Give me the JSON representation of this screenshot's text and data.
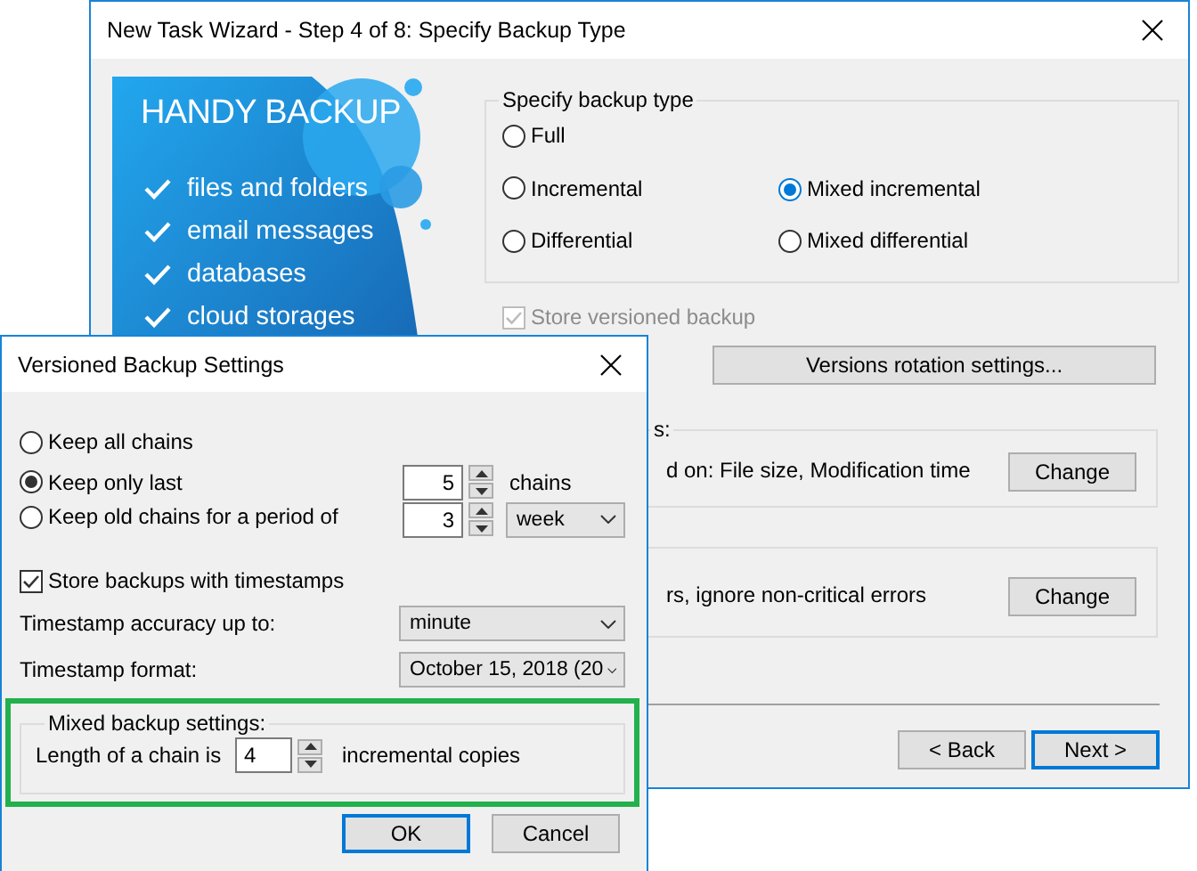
{
  "wizard": {
    "title": "New Task Wizard - Step 4 of 8: Specify Backup Type",
    "banner": {
      "title": "HANDY BACKUP",
      "features": [
        "files and folders",
        "email messages",
        "databases",
        "cloud storages"
      ]
    },
    "backup_type": {
      "label": "Specify backup type",
      "options": [
        {
          "label": "Full",
          "selected": false
        },
        {
          "label": "Incremental",
          "selected": false
        },
        {
          "label": "Mixed incremental",
          "selected": true
        },
        {
          "label": "Differential",
          "selected": false
        },
        {
          "label": "Mixed differential",
          "selected": false
        }
      ]
    },
    "store_versioned": {
      "label": "Store versioned backup",
      "checked": true,
      "disabled": true
    },
    "rotation_button": "Versions rotation settings...",
    "groups": [
      {
        "label": "s:",
        "text": "d on: File size, Modification time",
        "button": "Change"
      },
      {
        "text": "rs, ignore non-critical errors",
        "button": "Change"
      }
    ],
    "buttons": [
      {
        "label": "< Back",
        "default": false
      },
      {
        "label": "Next >",
        "default": true
      }
    ]
  },
  "dialog": {
    "title": "Versioned Backup Settings",
    "keep_options": [
      {
        "label": "Keep all chains",
        "selected": false
      },
      {
        "label": "Keep only last",
        "selected": true,
        "spin": "5",
        "unit": "chains"
      },
      {
        "label": "Keep old chains for a period of",
        "selected": false,
        "spin": "3",
        "dropdown": "week"
      }
    ],
    "timestamps": {
      "label": "Store backups with timestamps",
      "checked": true
    },
    "accuracy": {
      "label": "Timestamp accuracy up to:",
      "value": "minute"
    },
    "format": {
      "label": "Timestamp format:",
      "value": "October 15, 2018 (20"
    },
    "mixed": {
      "label": "Mixed backup settings:",
      "text": "Length of a chain is",
      "spin": "4",
      "unit": "incremental copies",
      "highlighted": true
    },
    "buttons": [
      {
        "label": "OK",
        "default": true
      },
      {
        "label": "Cancel",
        "default": false
      }
    ]
  }
}
